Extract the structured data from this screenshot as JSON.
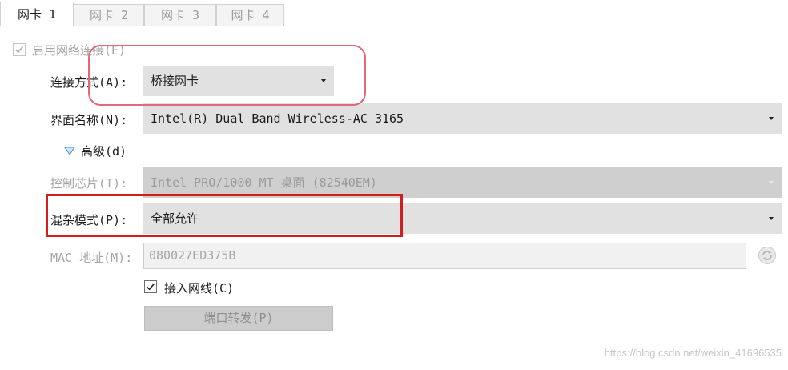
{
  "tabs": [
    {
      "label": "网卡 1",
      "active": true
    },
    {
      "label": "网卡 2",
      "active": false
    },
    {
      "label": "网卡 3",
      "active": false
    },
    {
      "label": "网卡 4",
      "active": false
    }
  ],
  "enable_network": {
    "label": "启用网络连接(E)",
    "checked": true,
    "enabled": false
  },
  "attached_to": {
    "label": "连接方式(A):",
    "value": "桥接网卡"
  },
  "interface_name": {
    "label": "界面名称(N):",
    "value": "Intel(R) Dual Band Wireless-AC 3165"
  },
  "advanced": {
    "label": "高级(d)",
    "expanded": true
  },
  "adapter_type": {
    "label": "控制芯片(T):",
    "value": "Intel PRO/1000 MT 桌面 (82540EM)",
    "enabled": false
  },
  "promiscuous_mode": {
    "label": "混杂模式(P):",
    "value": "全部允许"
  },
  "mac_address": {
    "label": "MAC 地址(M):",
    "value": "080027ED375B",
    "enabled": false
  },
  "cable_connected": {
    "label": "接入网线(C)",
    "checked": true
  },
  "port_forwarding": {
    "label": "端口转发(P)",
    "enabled": false
  },
  "icons": {
    "refresh_mac": "refresh-icon",
    "advanced_toggle": "triangle-down-icon",
    "dropdown": "dropdown-arrow-icon"
  },
  "colors": {
    "highlight_rounded": "#e0697a",
    "highlight_rect": "#d21e1e",
    "accent_triangle": "#3b8fd6"
  },
  "watermark": "https://blog.csdn.net/weixin_41696535"
}
